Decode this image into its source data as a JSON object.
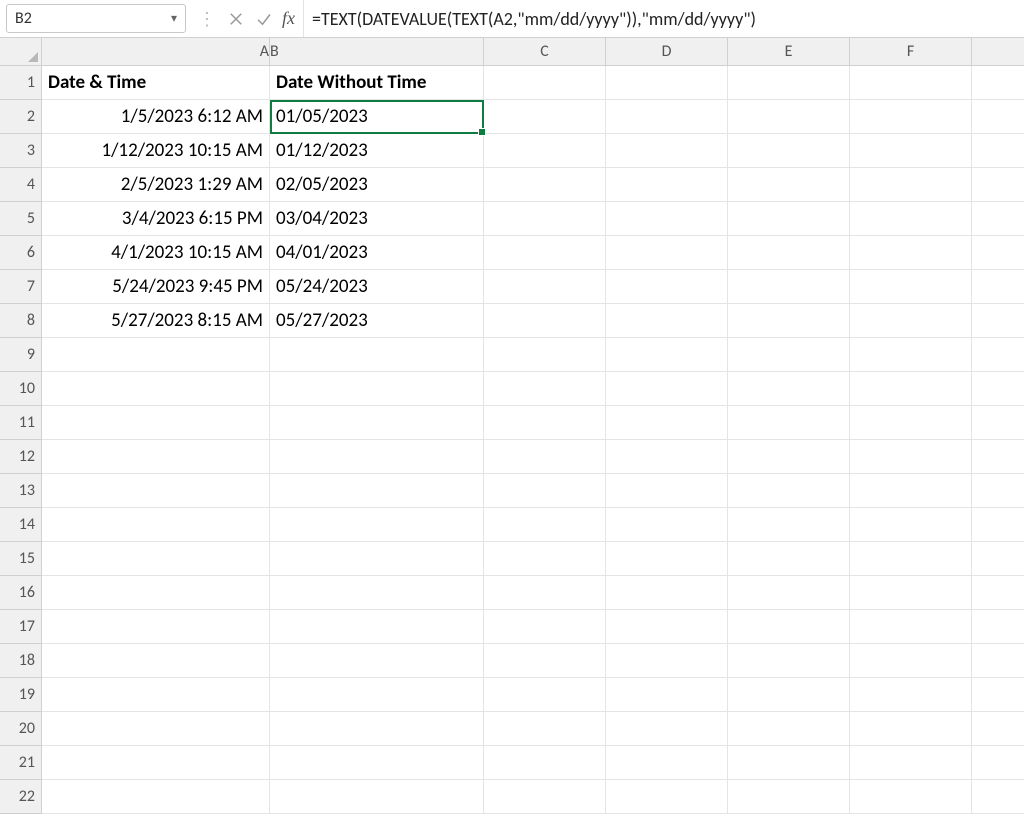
{
  "nameBox": {
    "value": "B2"
  },
  "formulaBar": {
    "fxLabel": "fx",
    "formula": "=TEXT(DATEVALUE(TEXT(A2,\"mm/dd/yyyy\")),\"mm/dd/yyyy\")"
  },
  "columns": [
    "A",
    "B",
    "C",
    "D",
    "E",
    "F"
  ],
  "rowCount": 22,
  "headers": {
    "A": "Date & Time",
    "B": "Date Without Time"
  },
  "rows": [
    {
      "A": "1/5/2023 6:12 AM",
      "B": "01/05/2023"
    },
    {
      "A": "1/12/2023 10:15 AM",
      "B": "01/12/2023"
    },
    {
      "A": "2/5/2023 1:29 AM",
      "B": "02/05/2023"
    },
    {
      "A": "3/4/2023 6:15 PM",
      "B": "03/04/2023"
    },
    {
      "A": "4/1/2023 10:15 AM",
      "B": "04/01/2023"
    },
    {
      "A": "5/24/2023 9:45 PM",
      "B": "05/24/2023"
    },
    {
      "A": "5/27/2023 8:15 AM",
      "B": "05/27/2023"
    }
  ],
  "selectedCell": "B2"
}
